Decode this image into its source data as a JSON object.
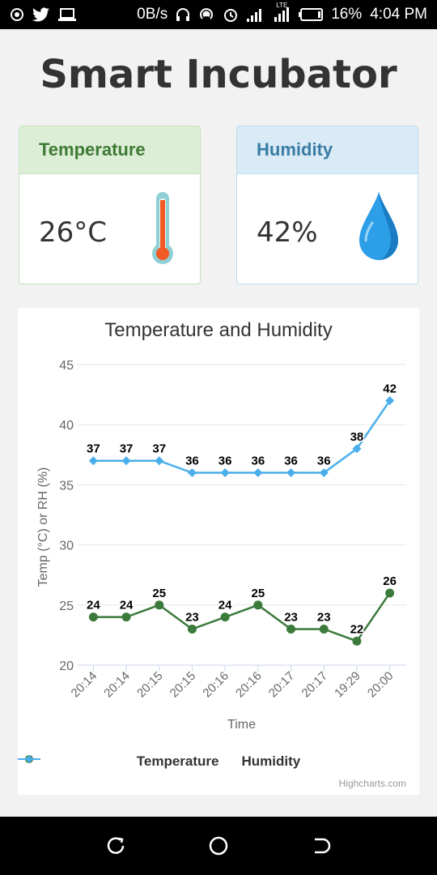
{
  "status_bar": {
    "net_speed": "0B/s",
    "battery": "16%",
    "time": "4:04 PM",
    "lte": "LTE"
  },
  "app": {
    "title": "Smart Incubator"
  },
  "cards": {
    "temperature": {
      "label": "Temperature",
      "value": "26°C",
      "color": "#3d7a35"
    },
    "humidity": {
      "label": "Humidity",
      "value": "42%",
      "color": "#3a7ca5"
    }
  },
  "chart_data": {
    "type": "line",
    "title": "Temperature and Humidity",
    "xlabel": "Time",
    "ylabel": "Temp (°C) or RH (%)",
    "categories": [
      "20:14",
      "20:14",
      "20:15",
      "20:15",
      "20:16",
      "20:16",
      "20:17",
      "20:17",
      "19:29",
      "20:00"
    ],
    "ylim": [
      20,
      45
    ],
    "yticks": [
      20,
      25,
      30,
      35,
      40,
      45
    ],
    "grid": true,
    "legend_position": "bottom",
    "series": [
      {
        "name": "Temperature",
        "color": "#3c7a3c",
        "marker": "circle",
        "values": [
          24,
          24,
          25,
          23,
          24,
          25,
          23,
          23,
          22,
          26
        ]
      },
      {
        "name": "Humidity",
        "color": "#4aaeea",
        "marker": "diamond",
        "values": [
          37,
          37,
          37,
          36,
          36,
          36,
          36,
          36,
          38,
          42
        ]
      }
    ],
    "credits": "Highcharts.com"
  },
  "nav": {
    "back": "back-icon",
    "home": "home-icon",
    "recents": "recents-icon"
  }
}
